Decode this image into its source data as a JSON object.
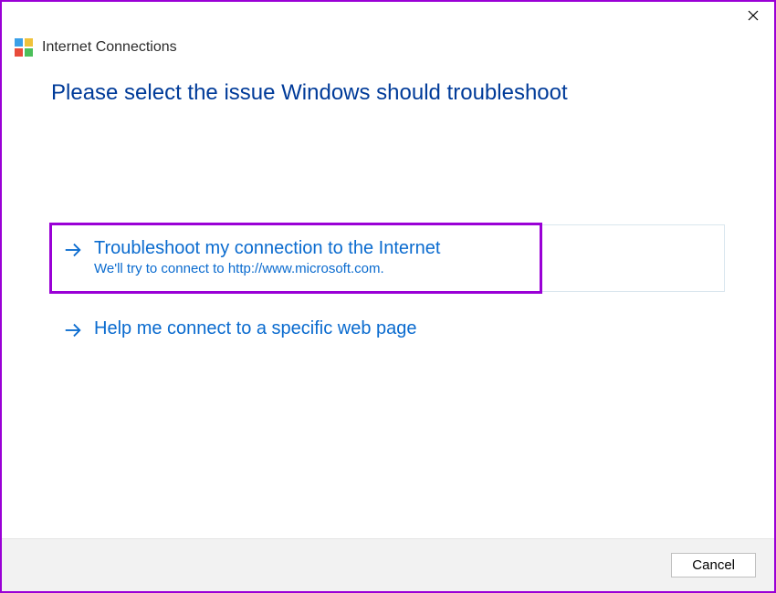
{
  "app_title": "Internet Connections",
  "heading": "Please select the issue Windows should troubleshoot",
  "options": [
    {
      "title": "Troubleshoot my connection to the Internet",
      "sub": "We'll try to connect to http://www.microsoft.com."
    },
    {
      "title": "Help me connect to a specific web page",
      "sub": ""
    }
  ],
  "footer": {
    "cancel_label": "Cancel"
  }
}
